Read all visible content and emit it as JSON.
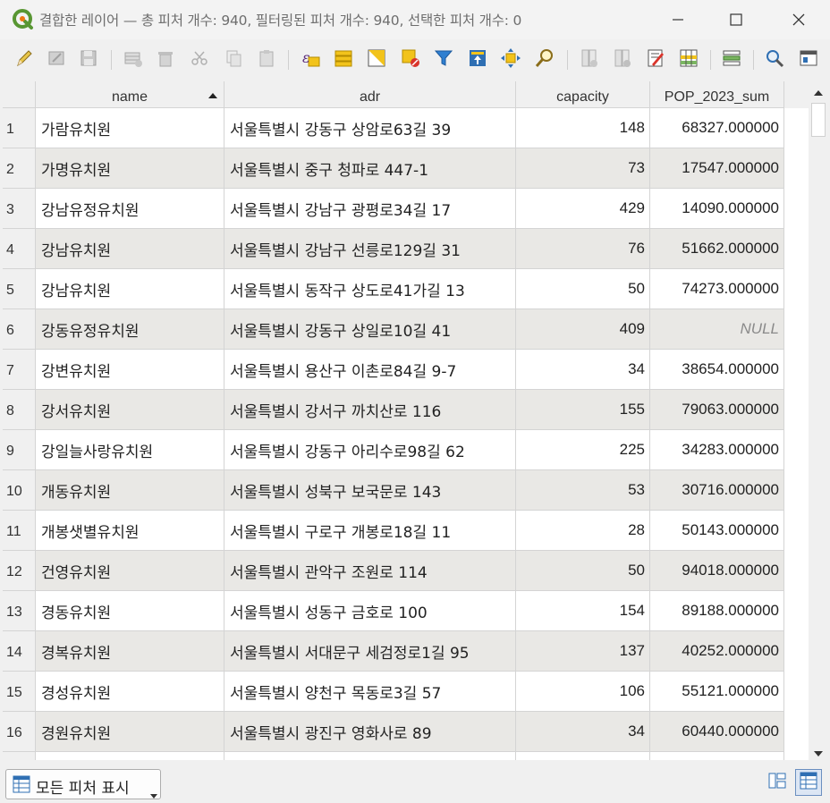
{
  "window": {
    "title": "결합한 레이어 — 총 피처 개수: 940, 필터링된 피처 개수: 940, 선택한 피처 개수: 0"
  },
  "toolbar": {
    "buttons": [
      {
        "name": "toggle-editing",
        "icon": "pencil-icon"
      },
      {
        "name": "toggle-multi-edit",
        "icon": "multi-edit-icon"
      },
      {
        "name": "save-edits",
        "icon": "save-icon"
      },
      {
        "name": "add-feature",
        "icon": "add-row-icon"
      },
      {
        "name": "delete-feature",
        "icon": "trash-icon"
      },
      {
        "name": "cut-features",
        "icon": "scissors-icon"
      },
      {
        "name": "copy-features",
        "icon": "copy-icon"
      },
      {
        "name": "paste-features",
        "icon": "paste-icon"
      },
      {
        "name": "select-by-expression",
        "icon": "expression-icon"
      },
      {
        "name": "select-all",
        "icon": "select-all-icon"
      },
      {
        "name": "invert-selection",
        "icon": "invert-icon"
      },
      {
        "name": "deselect-all",
        "icon": "deselect-icon"
      },
      {
        "name": "filter-select",
        "icon": "funnel-icon"
      },
      {
        "name": "move-selection-top",
        "icon": "move-top-icon"
      },
      {
        "name": "pan-to-selection",
        "icon": "pan-icon"
      },
      {
        "name": "zoom-to-selection",
        "icon": "zoom-icon"
      },
      {
        "name": "new-field",
        "icon": "new-field-icon"
      },
      {
        "name": "delete-field",
        "icon": "delete-field-icon"
      },
      {
        "name": "field-calculator",
        "icon": "calculator-icon"
      },
      {
        "name": "conditional-formatting",
        "icon": "conditional-format-icon"
      },
      {
        "name": "organize-columns",
        "icon": "organize-columns-icon"
      },
      {
        "name": "actions",
        "icon": "actions-icon"
      },
      {
        "name": "dock-window",
        "icon": "dock-icon"
      }
    ]
  },
  "table": {
    "columns": [
      "name",
      "adr",
      "capacity",
      "POP_2023_sum"
    ],
    "rows": [
      {
        "n": "1",
        "name": "가람유치원",
        "adr": "서울특별시 강동구 상암로63길 39",
        "capacity": "148",
        "pop": "68327.000000"
      },
      {
        "n": "2",
        "name": "가명유치원",
        "adr": "서울특별시 중구 청파로 447-1",
        "capacity": "73",
        "pop": "17547.000000"
      },
      {
        "n": "3",
        "name": "강남유정유치원",
        "adr": "서울특별시 강남구 광평로34길 17",
        "capacity": "429",
        "pop": "14090.000000"
      },
      {
        "n": "4",
        "name": "강남유치원",
        "adr": "서울특별시 강남구 선릉로129길 31",
        "capacity": "76",
        "pop": "51662.000000"
      },
      {
        "n": "5",
        "name": "강남유치원",
        "adr": "서울특별시 동작구 상도로41가길 13",
        "capacity": "50",
        "pop": "74273.000000"
      },
      {
        "n": "6",
        "name": "강동유정유치원",
        "adr": "서울특별시 강동구 상일로10길 41",
        "capacity": "409",
        "pop": "NULL"
      },
      {
        "n": "7",
        "name": "강변유치원",
        "adr": "서울특별시 용산구 이촌로84길 9-7",
        "capacity": "34",
        "pop": "38654.000000"
      },
      {
        "n": "8",
        "name": "강서유치원",
        "adr": "서울특별시 강서구 까치산로 116",
        "capacity": "155",
        "pop": "79063.000000"
      },
      {
        "n": "9",
        "name": "강일늘사랑유치원",
        "adr": "서울특별시 강동구 아리수로98길 62",
        "capacity": "225",
        "pop": "34283.000000"
      },
      {
        "n": "10",
        "name": "개동유치원",
        "adr": "서울특별시 성북구 보국문로 143",
        "capacity": "53",
        "pop": "30716.000000"
      },
      {
        "n": "11",
        "name": "개봉샛별유치원",
        "adr": "서울특별시 구로구 개봉로18길 11",
        "capacity": "28",
        "pop": "50143.000000"
      },
      {
        "n": "12",
        "name": "건영유치원",
        "adr": "서울특별시 관악구 조원로 114",
        "capacity": "50",
        "pop": "94018.000000"
      },
      {
        "n": "13",
        "name": "경동유치원",
        "adr": "서울특별시 성동구 금호로 100",
        "capacity": "154",
        "pop": "89188.000000"
      },
      {
        "n": "14",
        "name": "경복유치원",
        "adr": "서울특별시 서대문구 세검정로1길 95",
        "capacity": "137",
        "pop": "40252.000000"
      },
      {
        "n": "15",
        "name": "경성유치원",
        "adr": "서울특별시 양천구 목동로3길 57",
        "capacity": "106",
        "pop": "55121.000000"
      },
      {
        "n": "16",
        "name": "경원유치원",
        "adr": "서울특별시 광진구 영화사로 89",
        "capacity": "34",
        "pop": "60440.000000"
      }
    ]
  },
  "statusbar": {
    "filter_label": "모든 피처 표시"
  },
  "colors": {
    "alt_row": "#e9e8e5",
    "grid": "#d4d4d4",
    "null_text": "#8a8a8a",
    "accent_blue": "#2f6fb3",
    "accent_yellow": "#f2c31b"
  }
}
